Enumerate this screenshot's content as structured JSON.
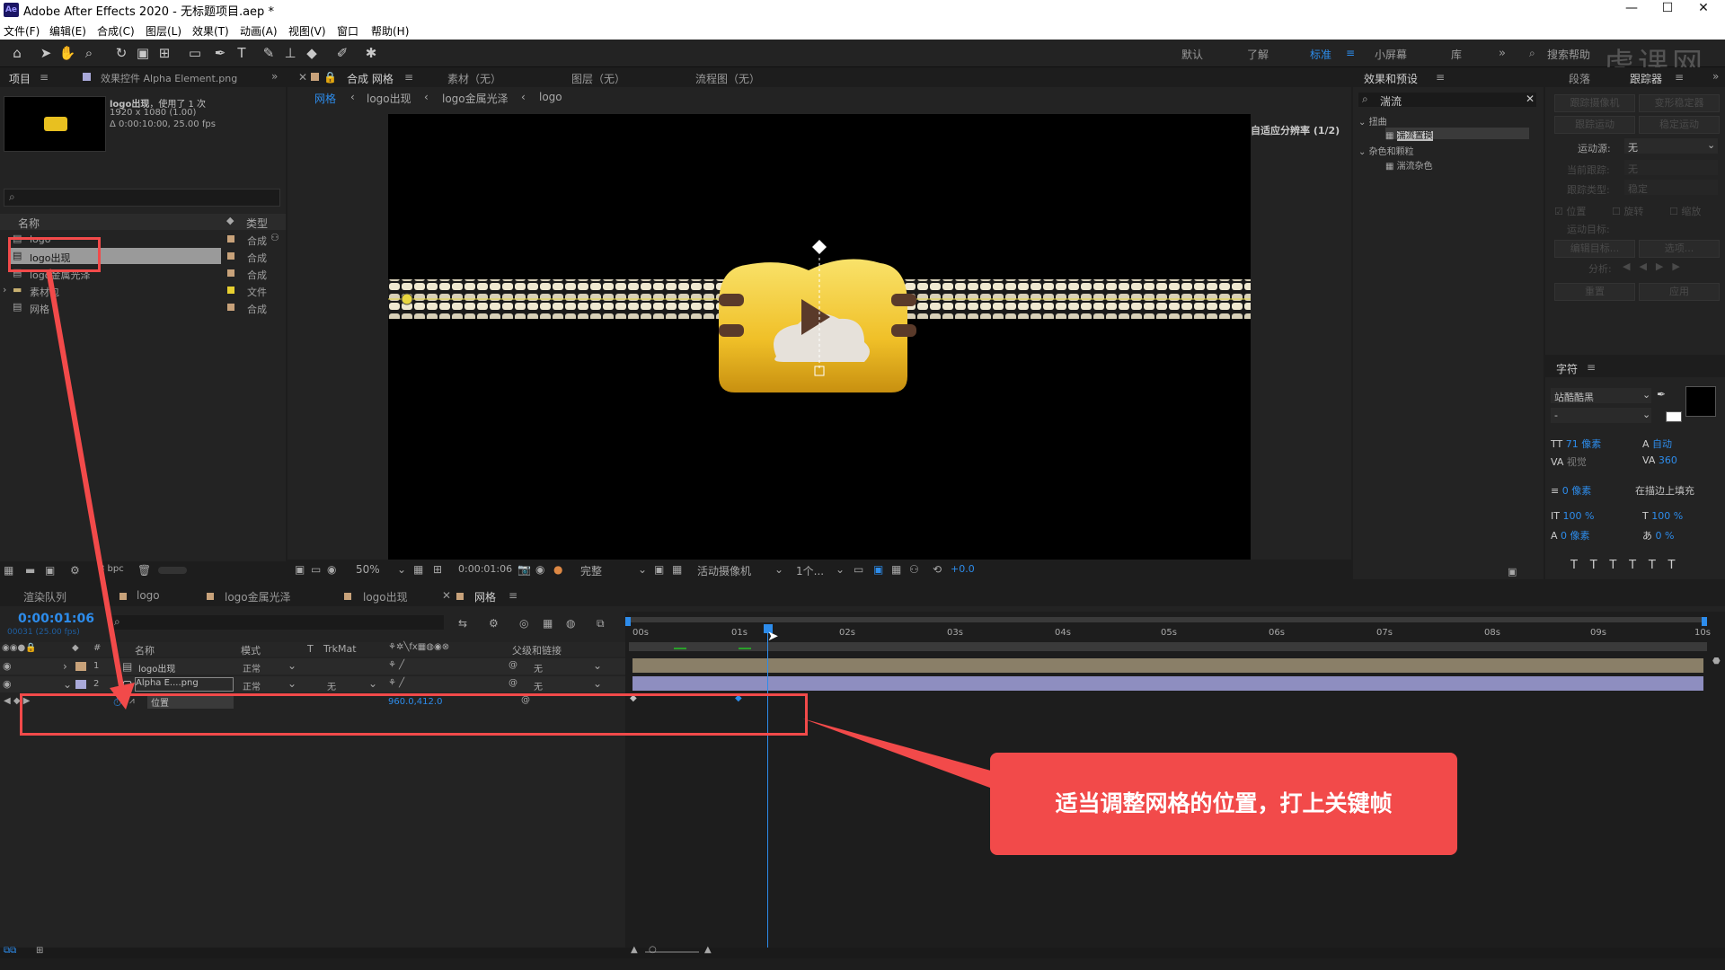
{
  "app": {
    "title": "Adobe After Effects 2020 - 无标题项目.aep *",
    "icon": "Ae"
  },
  "menu": [
    "文件(F)",
    "编辑(E)",
    "合成(C)",
    "图层(L)",
    "效果(T)",
    "动画(A)",
    "视图(V)",
    "窗口",
    "帮助(H)"
  ],
  "workspaces": [
    "默认",
    "了解",
    "标准",
    "小屏幕",
    "库"
  ],
  "active_workspace": "标准",
  "search_help": "搜索帮助",
  "watermark": "虎课网",
  "project_panel": {
    "tab_label": "项目",
    "effects_tab": "效果控件 Alpha Element.png",
    "comp_name": "logo出现",
    "used": "，使用了 1 次",
    "res": "1920 x 1080 (1.00)",
    "duration": "Δ 0:00:10:00, 25.00 fps",
    "col_name": "名称",
    "col_type": "类型",
    "items": [
      {
        "name": "logo",
        "type": "合成"
      },
      {
        "name": "logo出现",
        "type": "合成"
      },
      {
        "name": "logo金属光泽",
        "type": "合成"
      },
      {
        "name": "素材包",
        "type": "文件"
      },
      {
        "name": "网格",
        "type": "合成"
      }
    ],
    "bpc": "8 bpc"
  },
  "comp_panel": {
    "tabs": [
      "合成 网格",
      "素材（无）",
      "图层（无）",
      "流程图（无）"
    ],
    "breadcrumbs": [
      "网格",
      "logo出现",
      "logo金属光泽",
      "logo"
    ],
    "adaptive": "自适应分辨率 (1/2)",
    "zoom": "50%",
    "timecode": "0:00:01:06",
    "quality": "完整",
    "camera": "活动摄像机",
    "views": "1个...",
    "exposure": "+0.0"
  },
  "effects_panel": {
    "title": "效果和预设",
    "search": "湍流",
    "groups": [
      {
        "name": "扭曲",
        "items": [
          "湍流置换"
        ]
      },
      {
        "name": "杂色和颗粒",
        "items": [
          "湍流杂色"
        ]
      }
    ]
  },
  "tracker_panel": {
    "tabs": [
      "段落",
      "跟踪器"
    ],
    "buttons": [
      "跟踪摄像机",
      "变形稳定器",
      "跟踪运动",
      "稳定运动"
    ],
    "motion_source_label": "运动源:",
    "motion_source_value": "无",
    "current_track_label": "当前跟踪:",
    "current_track_value": "无",
    "track_type_label": "跟踪类型:",
    "track_type_value": "稳定",
    "checks": [
      "位置",
      "旋转",
      "缩放"
    ],
    "motion_target": "运动目标:",
    "edit_target": "编辑目标...",
    "options": "选项...",
    "analyze": "分析:",
    "reset": "重置",
    "apply": "应用"
  },
  "char_panel": {
    "title": "字符",
    "font": "站酷酷黑",
    "style": "-",
    "size": "71 像素",
    "leading": "自动",
    "kerning": "视觉",
    "tracking": "360",
    "stroke": "0 像素",
    "stroke_mode": "在描边上填充",
    "vscale": "100 %",
    "hscale": "100 %",
    "baseline": "0 像素",
    "tsume": "0 %"
  },
  "timeline": {
    "tabs": [
      "渲染队列",
      "logo",
      "logo金属光泽",
      "logo出现",
      "网格"
    ],
    "timecode": "0:00:01:06",
    "frames": "00031 (25.00 fps)",
    "cols": {
      "name": "名称",
      "mode": "模式",
      "t": "T",
      "trkmat": "TrkMat",
      "parent": "父级和链接"
    },
    "layers": [
      {
        "num": "1",
        "name": "logo出现",
        "mode": "正常",
        "trkmat": "",
        "parent": "无"
      },
      {
        "num": "2",
        "name": "Alpha E....png",
        "mode": "正常",
        "trkmat": "无",
        "parent": "无"
      }
    ],
    "property": {
      "name": "位置",
      "value": "960.0,412.0"
    },
    "ruler": [
      "00s",
      "01s",
      "02s",
      "03s",
      "04s",
      "05s",
      "06s",
      "07s",
      "08s",
      "09s",
      "10s"
    ]
  },
  "annotation": "适当调整网格的位置，打上关键帧",
  "colors": {
    "accent": "#2d8ceb",
    "annotation": "#f24a4a",
    "label_tan": "#c8a27a",
    "label_lavender": "#a9a9d9"
  }
}
